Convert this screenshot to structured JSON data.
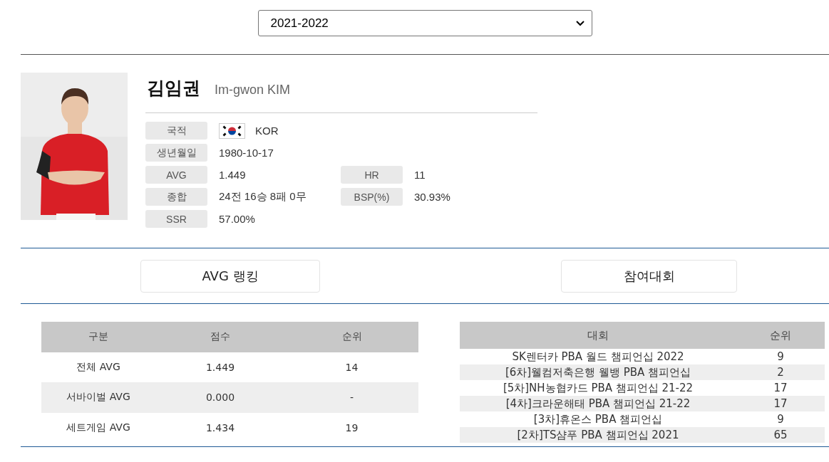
{
  "season_select": {
    "value": "2021-2022"
  },
  "player": {
    "name_ko": "김임권",
    "name_en": "Im-gwon KIM",
    "fields": [
      {
        "label": "국적",
        "value": "KOR",
        "flag": true
      },
      {
        "label": "생년월일",
        "value": "1980-10-17"
      },
      {
        "label": "AVG",
        "value": "1.449",
        "label2": "HR",
        "value2": "11"
      },
      {
        "label": "종합",
        "value": "24전 16승 8패 0무",
        "label2": "BSP(%)",
        "value2": "30.93%"
      },
      {
        "label": "SSR",
        "value": "57.00%"
      }
    ]
  },
  "section_buttons": [
    "AVG 랭킹",
    "참여대회"
  ],
  "avg_table": {
    "columns": [
      "구분",
      "점수",
      "순위"
    ],
    "rows": [
      [
        "전체 AVG",
        "1.449",
        "14"
      ],
      [
        "서바이벌 AVG",
        "0.000",
        "-"
      ],
      [
        "세트게임 AVG",
        "1.434",
        "19"
      ]
    ]
  },
  "tournament_table": {
    "columns": [
      "대회",
      "순위"
    ],
    "rows": [
      [
        "SK렌터카 PBA 월드 챔피언십 2022",
        "9"
      ],
      [
        "[6차]웰컴저축은행 웰뱅 PBA 챔피언십",
        "2"
      ],
      [
        "[5차]NH농협카드 PBA 챔피언십 21-22",
        "17"
      ],
      [
        "[4차]크라운해태 PBA 챔피언십 21-22",
        "17"
      ],
      [
        "[3차]휴온스 PBA 챔피언십",
        "9"
      ],
      [
        "[2차]TS샴푸 PBA 챔피언십 2021",
        "65"
      ]
    ]
  }
}
